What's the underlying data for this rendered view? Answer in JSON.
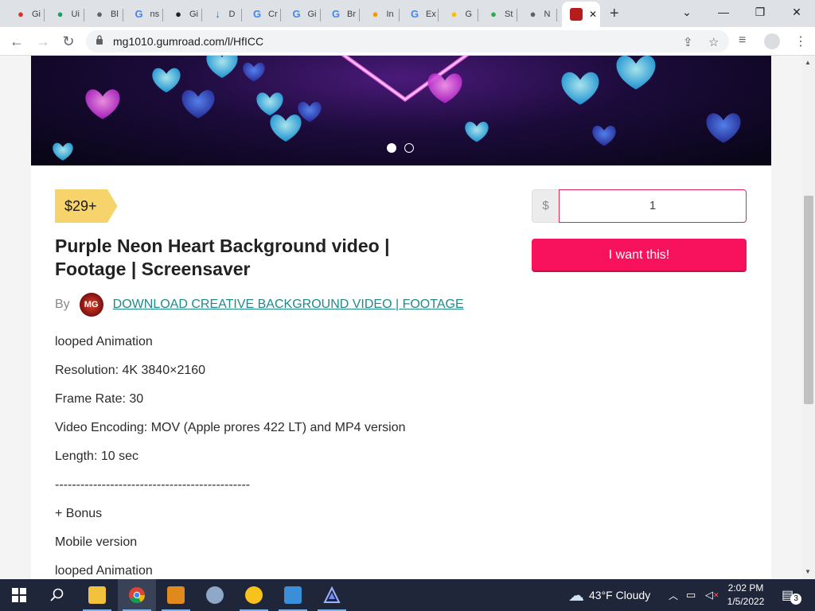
{
  "browser": {
    "tabs": [
      {
        "label": "Gi",
        "color": "#d93025",
        "glyph": "●"
      },
      {
        "label": "Ui",
        "color": "#1aa260",
        "glyph": "●"
      },
      {
        "label": "Bl",
        "color": "#5f6368",
        "glyph": "●"
      },
      {
        "label": "ns",
        "color": "#4285f4",
        "glyph": "G"
      },
      {
        "label": "Gi",
        "color": "#202124",
        "glyph": "●"
      },
      {
        "label": "D",
        "color": "#1a73e8",
        "glyph": "↓"
      },
      {
        "label": "Cr",
        "color": "#4285f4",
        "glyph": "G"
      },
      {
        "label": "Gi",
        "color": "#4285f4",
        "glyph": "G"
      },
      {
        "label": "Br",
        "color": "#4285f4",
        "glyph": "G"
      },
      {
        "label": "In",
        "color": "#f29900",
        "glyph": "●"
      },
      {
        "label": "Ex",
        "color": "#4285f4",
        "glyph": "G"
      },
      {
        "label": "G",
        "color": "#fbbc04",
        "glyph": "●"
      },
      {
        "label": "St",
        "color": "#34a853",
        "glyph": "●"
      },
      {
        "label": "N",
        "color": "#5f6368",
        "glyph": "●"
      }
    ],
    "active_tab_close": "✕",
    "new_tab": "+",
    "url": "mg1010.gumroad.com/l/HfICC"
  },
  "product": {
    "price_tag": "$29+",
    "title": "Purple Neon Heart Background video | Footage | Screensaver",
    "by_label": "By",
    "avatar_text": "MG",
    "creator": "DOWNLOAD CREATIVE BACKGROUND VIDEO | FOOTAGE",
    "currency": "$",
    "price_value": "1",
    "buy_label": "I want this!",
    "description": [
      "looped Animation",
      "Resolution: 4K 3840×2160",
      "Frame Rate: 30",
      "Video Encoding: MOV (Apple prores 422 LT) and MP4 version",
      "Length: 10 sec",
      "----------------------------------------------",
      "+ Bonus",
      "Mobile version",
      "looped Animation"
    ]
  },
  "taskbar": {
    "weather": "43°F  Cloudy",
    "time": "2:02 PM",
    "date": "1/5/2022",
    "notification_count": "3"
  }
}
